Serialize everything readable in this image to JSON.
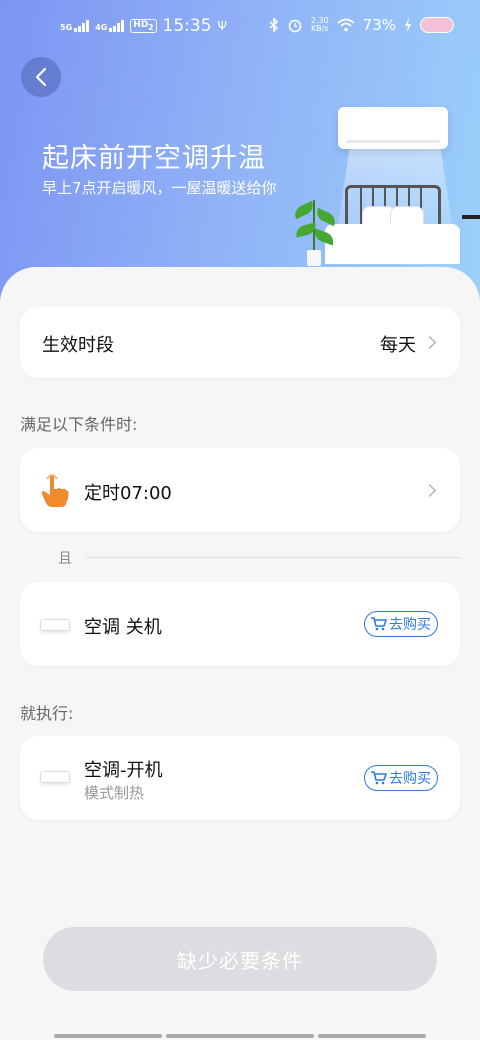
{
  "status_bar": {
    "time": "15:35",
    "net1": "5G",
    "net2": "4G",
    "hd": "HD",
    "hd_sub": "2",
    "usb_glyph": "Ψ",
    "net_speed_value": "2.30",
    "net_speed_unit": "KB/s",
    "battery": "73%",
    "icons": [
      "signal-icon",
      "signal-icon",
      "hd-icon",
      "usb-icon",
      "bluetooth-icon",
      "alarm-icon",
      "wifi-icon",
      "charging-icon",
      "battery-icon"
    ]
  },
  "header": {
    "title": "起床前开空调升温",
    "subtitle": "早上7点开启暖风，一屋温暖送给你",
    "back_icon": "back-arrow-icon"
  },
  "schedule": {
    "label": "生效时段",
    "value": "每天"
  },
  "conditions": {
    "section_label": "满足以下条件时:",
    "timer_label": "定时07:00",
    "timer_icon": "tap-hand-icon",
    "and_label": "且",
    "device_label": "空调 关机",
    "buy_label": "去购买"
  },
  "actions": {
    "section_label": "就执行:",
    "device_label": "空调-开机",
    "device_sub": "模式制热",
    "buy_label": "去购买"
  },
  "primary_button": {
    "label": "缺少必要条件"
  },
  "colors": {
    "banner_start": "#7b95f3",
    "banner_end": "#9bd0fb",
    "accent_blue": "#2d7be5",
    "timer_orange": "#f08a2c",
    "disabled_button": "#dcdde1"
  }
}
